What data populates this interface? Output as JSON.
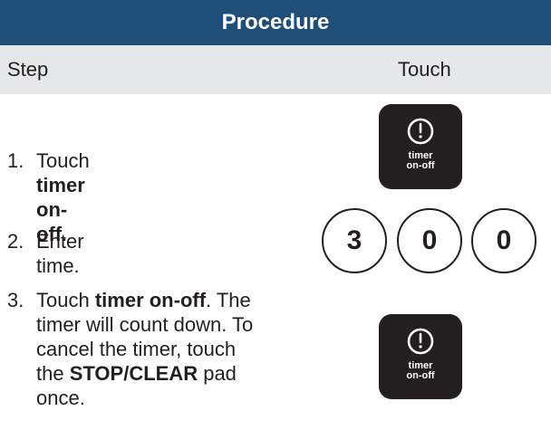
{
  "header": {
    "title": "Procedure"
  },
  "columns": {
    "step": "Step",
    "touch": "Touch"
  },
  "steps": [
    {
      "number": "1.",
      "lines": [
        {
          "pre": "Touch ",
          "bold": "timer on-off",
          "post": "."
        }
      ]
    },
    {
      "number": "2.",
      "lines": [
        {
          "pre": "Enter time.",
          "bold": "",
          "post": ""
        }
      ]
    },
    {
      "number": "3.",
      "lines": [
        {
          "pre": "Touch ",
          "bold": "timer on-off",
          "post": ". The"
        },
        {
          "pre": "timer will count down. To",
          "bold": "",
          "post": ""
        },
        {
          "pre": "cancel the timer, touch",
          "bold": "",
          "post": ""
        },
        {
          "pre": "the ",
          "bold": "STOP/CLEAR",
          "post": " pad"
        },
        {
          "pre": "once.",
          "bold": "",
          "post": ""
        }
      ]
    }
  ],
  "timer_pad": {
    "line1": "timer",
    "line2": "on-off",
    "icon": "timer-icon"
  },
  "digits": [
    "3",
    "0",
    "0"
  ],
  "colors": {
    "header_bg": "#1f4e79",
    "column_row_bg": "#e6e7e8",
    "pad_bg": "#231f20",
    "text": "#231f20"
  }
}
